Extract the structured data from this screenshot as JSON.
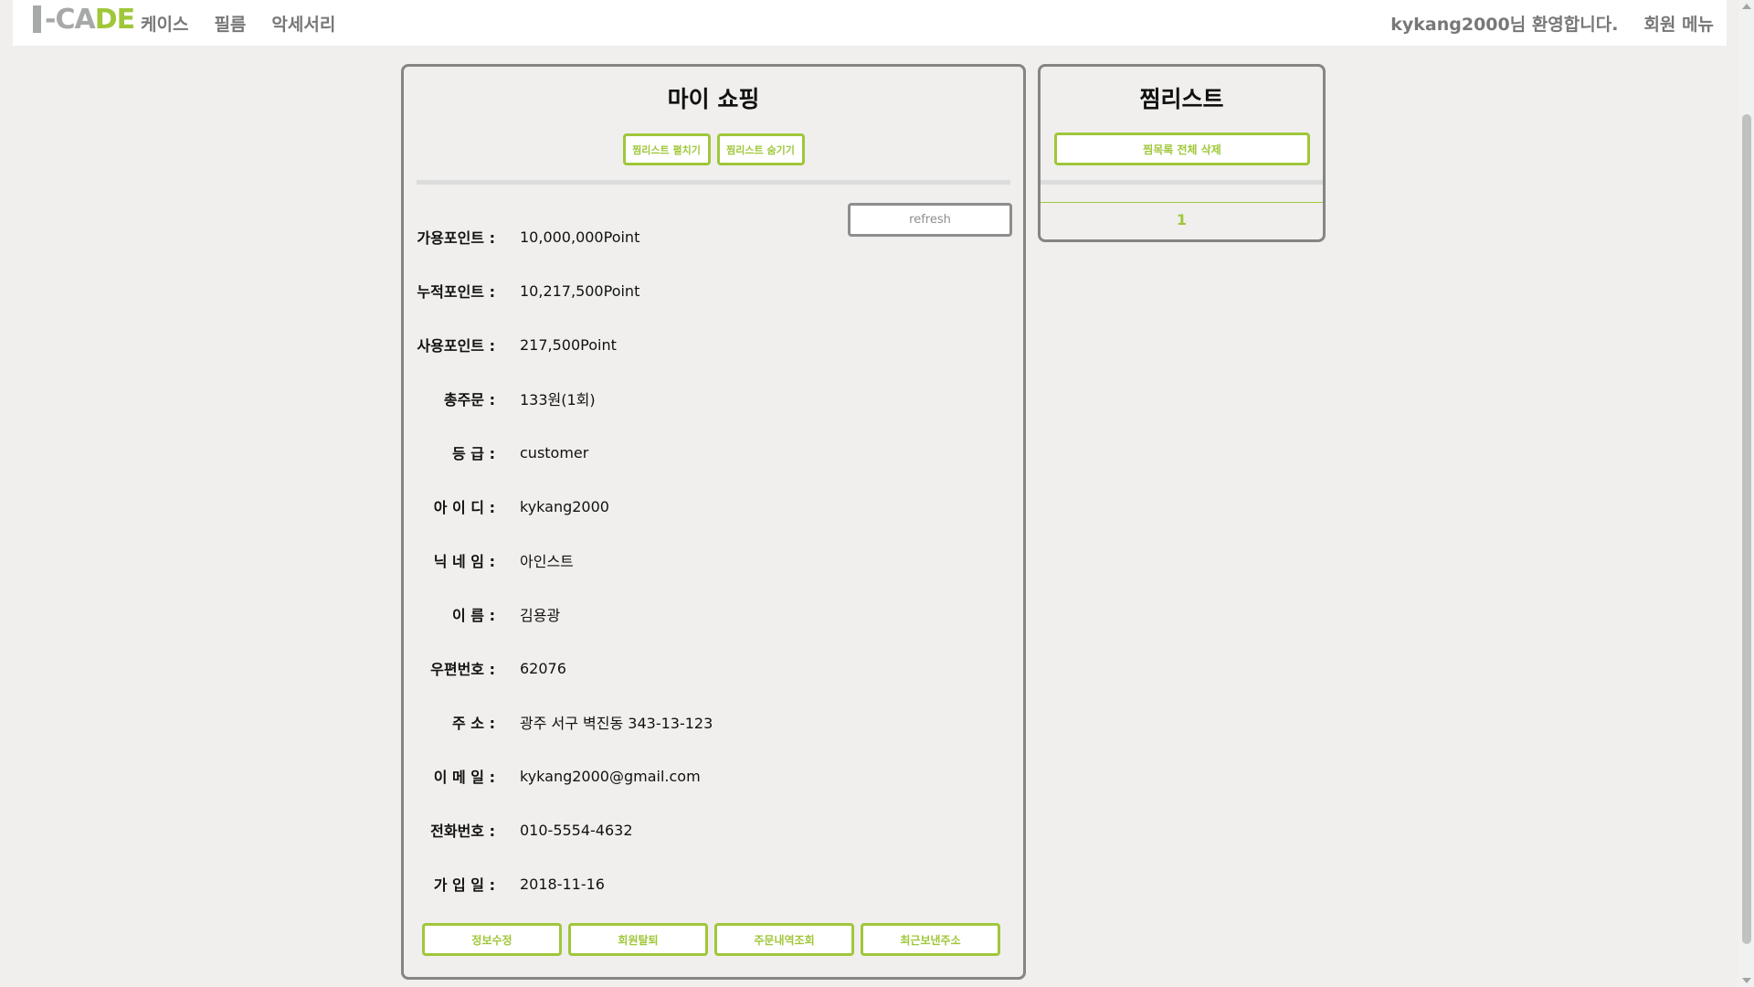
{
  "logo": {
    "text_a": "-",
    "text_b": "CA",
    "text_c": "DE"
  },
  "nav": {
    "items": [
      "케이스",
      "필름",
      "악세서리"
    ]
  },
  "user_menu": {
    "welcome": "kykang2000님 환영합니다.",
    "menu": "회원 메뉴"
  },
  "my_shopping": {
    "title": "마이 쇼핑",
    "wishlist_show": "찜리스트 펼치기",
    "wishlist_hide": "찜리스트 숨기기",
    "refresh": "refresh",
    "fields": [
      {
        "label": "가용포인트 :",
        "value": "10,000,000Point"
      },
      {
        "label": "누적포인트 :",
        "value": "10,217,500Point"
      },
      {
        "label": "사용포인트 :",
        "value": "217,500Point"
      },
      {
        "label": "총주문 :",
        "value": "133원(1회)"
      },
      {
        "label": "등 급 :",
        "value": "customer"
      },
      {
        "label": "아 이 디 :",
        "value": "kykang2000"
      },
      {
        "label": "닉 네 임 :",
        "value": "아인스트"
      },
      {
        "label": "이 름 :",
        "value": "김용광"
      },
      {
        "label": "우편번호 :",
        "value": "62076"
      },
      {
        "label": "주 소 :",
        "value": "광주 서구 벽진동 343-13-123"
      },
      {
        "label": "이 메 일 :",
        "value": "kykang2000@gmail.com"
      },
      {
        "label": "전화번호 :",
        "value": "010-5554-4632"
      },
      {
        "label": "가 입 일 :",
        "value": "2018-11-16"
      }
    ],
    "buttons": [
      "정보수정",
      "회원탈퇴",
      "주문내역조회",
      "최근보낸주소"
    ]
  },
  "wishlist": {
    "title": "찜리스트",
    "delete_all": "찜목록 전체 삭제",
    "page": "1"
  },
  "colors": {
    "accent": "#9fc73a",
    "border": "#858585",
    "background": "#f0efed"
  }
}
